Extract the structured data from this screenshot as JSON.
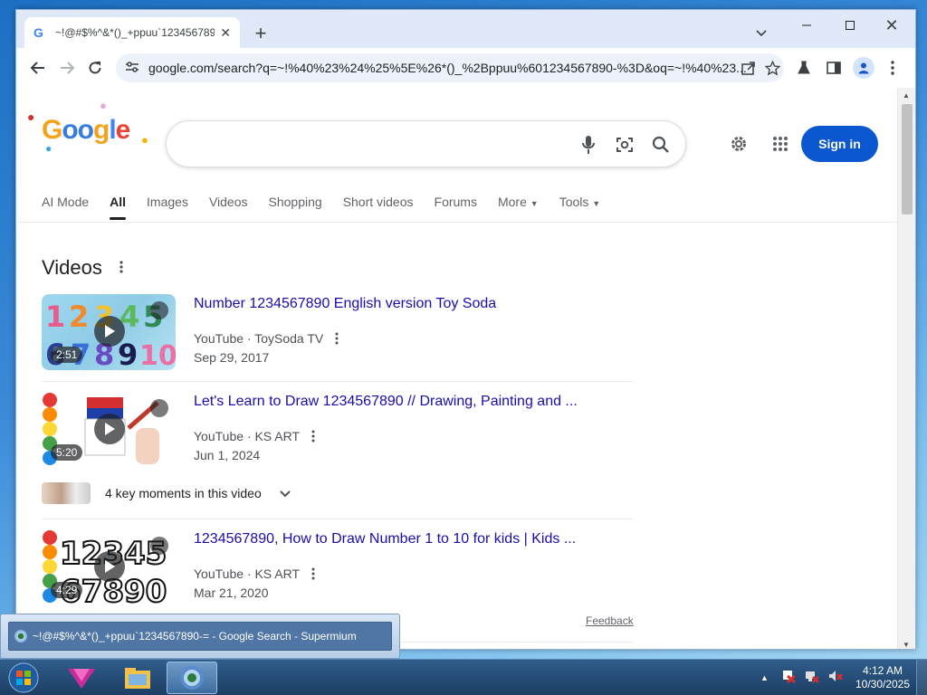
{
  "browser": {
    "tab_title": "~!@#$%^&*()_+ppuu`1234567890",
    "tab_favicon_text": "G",
    "url": "google.com/search?q=~!%40%23%24%25%5E%26*()_%2Bppuu%601234567890-%3D&oq=~!%40%23...",
    "icons": {
      "back": "arrow-left-icon",
      "forward": "arrow-right-icon",
      "reload": "reload-icon",
      "site_info": "tune-icon",
      "share": "share-icon",
      "bookmark": "star-icon",
      "labs": "flask-icon",
      "sidepanel": "side-panel-icon",
      "profile": "profile-icon",
      "menu": "three-dot-icon"
    }
  },
  "google": {
    "logo_text": "Google",
    "signin_label": "Sign in",
    "nav_tabs": [
      {
        "label": "AI Mode",
        "active": false
      },
      {
        "label": "All",
        "active": true
      },
      {
        "label": "Images",
        "active": false
      },
      {
        "label": "Videos",
        "active": false
      },
      {
        "label": "Shopping",
        "active": false
      },
      {
        "label": "Short videos",
        "active": false
      },
      {
        "label": "Forums",
        "active": false
      },
      {
        "label": "More",
        "active": false
      },
      {
        "label": "Tools",
        "active": false
      }
    ],
    "videos_heading": "Videos",
    "videos": [
      {
        "title": "Number 1234567890 English version Toy Soda",
        "source": "YouTube · ToySoda TV",
        "date": "Sep 29, 2017",
        "duration": "2:51"
      },
      {
        "title": "Let's Learn to Draw 1234567890 // Drawing, Painting and ...",
        "source": "YouTube · KS ART",
        "date": "Jun 1, 2024",
        "duration": "5:20"
      },
      {
        "title": "1234567890, How to Draw Number 1 to 10 for kids | Kids ...",
        "source": "YouTube · KS ART",
        "date": "Mar 21, 2020",
        "duration": "4:29"
      }
    ],
    "key_moments": "4 key moments in this video",
    "feedback": "Feedback"
  },
  "taskbar": {
    "preview_title": "~!@#$%^&*()_+ppuu`1234567890-= - Google Search - Supermium",
    "time": "4:12 AM",
    "date": "10/30/2025"
  },
  "colors": {
    "link": "#1a0dab",
    "signin": "#0b57d0",
    "accent_blue": "#4285f4"
  }
}
